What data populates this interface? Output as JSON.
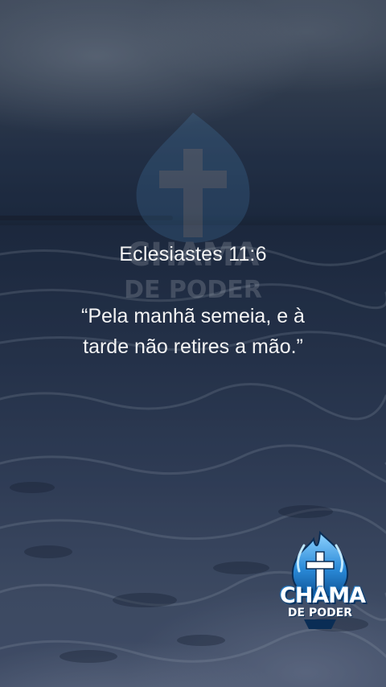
{
  "verse": {
    "reference": "Eclesiastes 11:6",
    "quote_line_1": "“Pela manhã semeia, e à",
    "quote_line_2": "tarde não retires a mão.”"
  },
  "logo": {
    "line_1": "CHAMA",
    "line_2": "DE PODER"
  },
  "watermark": {
    "line_1": "CHAMA",
    "line_2": "DE PODER"
  },
  "colors": {
    "text": "#f4f4f4",
    "flame_blue": "#2a8ad8",
    "sky": "#3a4556",
    "sea": "#37445f"
  },
  "icons": [
    "flame-cross-logo-icon",
    "flame-cross-watermark-icon"
  ]
}
